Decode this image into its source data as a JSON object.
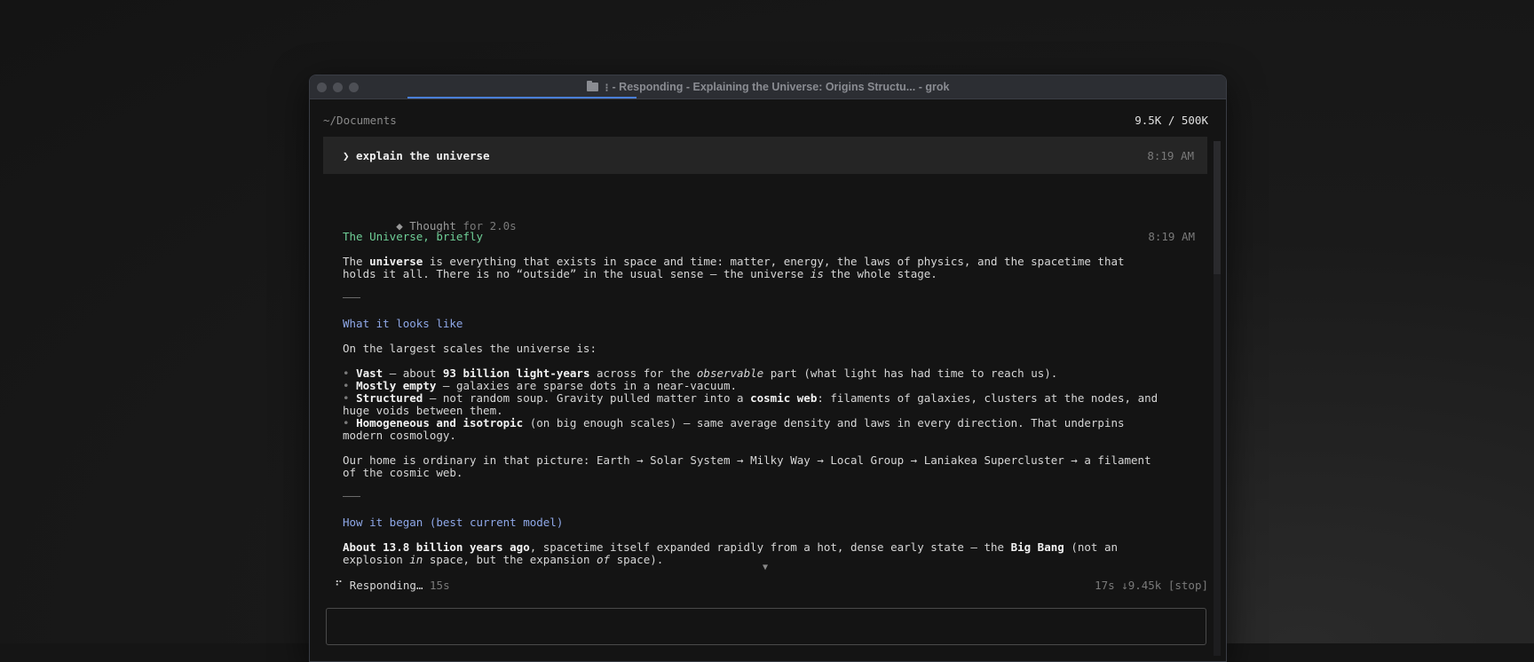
{
  "window": {
    "title_dots": "⁝",
    "title": "- Responding - Explaining the Universe: Origins Structu... - grok"
  },
  "header": {
    "path": "~/Documents",
    "tokens": "9.5K / 500K"
  },
  "prompt": {
    "text": "❯ explain the universe",
    "time": "8:19 AM"
  },
  "thought": {
    "icon": "◆",
    "label": "Thought",
    "duration": "for 2.0s"
  },
  "response": {
    "heading": "The Universe, briefly",
    "time": "8:19 AM",
    "intro": {
      "p1": "The ",
      "b1": "universe",
      "p2": " is everything that exists in space and time: matter, energy, the laws of physics, and the spacetime that",
      "line2a": "holds it all. There is no “outside” in the usual sense — the universe ",
      "i1": "is",
      "line2b": " the whole stage."
    },
    "section1": {
      "heading": "What it looks like",
      "lead": "On the largest scales the universe is:",
      "bullet": "•",
      "b1_bold": "Vast",
      "b1_a": " — about ",
      "b1_bold2": "93 billion light-years",
      "b1_b": " across for the ",
      "b1_i": "observable",
      "b1_c": " part (what light has had time to reach us).",
      "b2_bold": "Mostly empty",
      "b2_a": " — galaxies are sparse dots in a near-vacuum.",
      "b3_bold": "Structured",
      "b3_a": " — not random soup. Gravity pulled matter into a ",
      "b3_bold2": "cosmic web",
      "b3_b": ": filaments of galaxies, clusters at the nodes, and",
      "b3_line2": "huge voids between them.",
      "b4_bold": "Homogeneous and isotropic",
      "b4_a": " (on big enough scales) — same average density and laws in every direction. That underpins",
      "b4_line2": "modern cosmology.",
      "home_line1": "Our home is ordinary in that picture: Earth → Solar System → Milky Way → Local Group → Laniakea Supercluster → a filament",
      "home_line2": "of the cosmic web."
    },
    "section2": {
      "heading": "How it began (best current model)",
      "bold1": "About 13.8 billion years ago",
      "a": ", spacetime itself expanded rapidly from a hot, dense early state — the ",
      "bold2": "Big Bang",
      "b": " (not an",
      "line2a": "explosion ",
      "i1": "in",
      "line2b": " space, but the expansion ",
      "i2": "of",
      "line2c": " space)."
    }
  },
  "scroll_indicator": "▼",
  "status": {
    "spinner": "⠋",
    "label": "Responding…",
    "elapsed": "15s",
    "right": "17s ↓9.45k [stop]"
  }
}
